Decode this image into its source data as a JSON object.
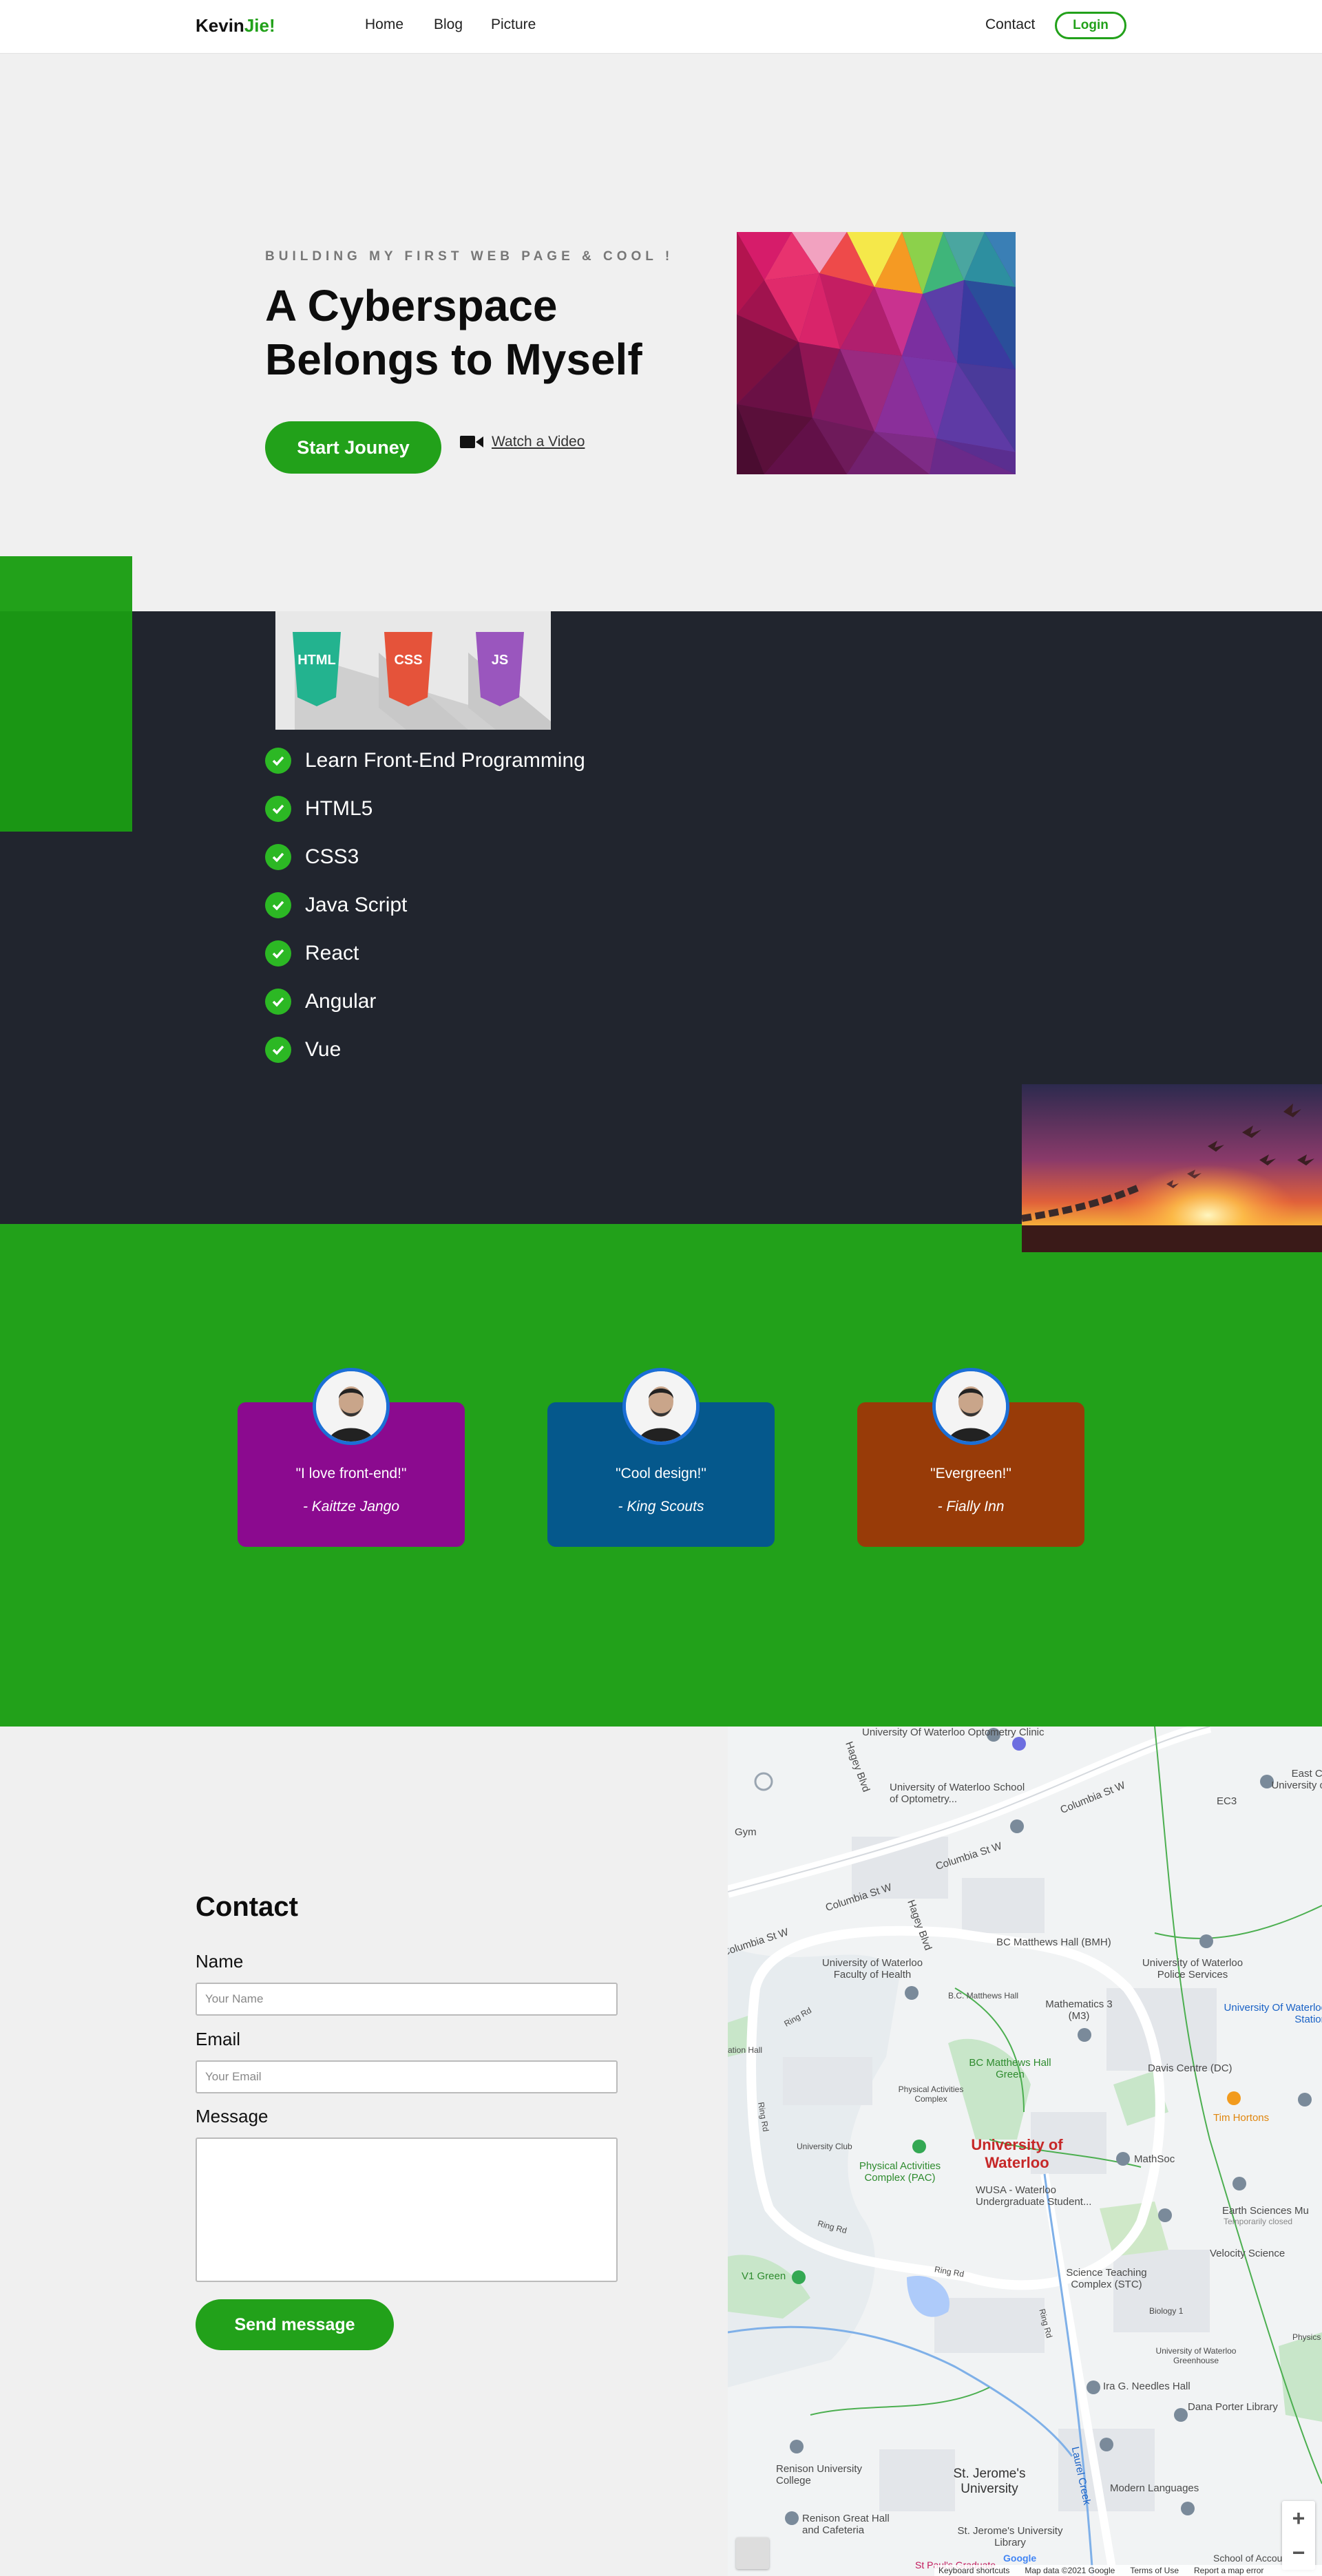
{
  "nav": {
    "brand_main": "Kevin",
    "brand_accent": "Jie!",
    "links": [
      "Home",
      "Blog",
      "Picture"
    ],
    "contact": "Contact",
    "login": "Login"
  },
  "hero": {
    "eyebrow": "BUILDING MY FIRST WEB PAGE & COOL !",
    "title_line1": "A Cyberspace",
    "title_line2": "Belongs to Myself",
    "cta": "Start Jouney",
    "watch": "Watch a Video"
  },
  "badges": [
    "HTML",
    "CSS",
    "JS"
  ],
  "skills": [
    "Learn Front-End Programming",
    "HTML5",
    "CSS3",
    "Java Script",
    "React",
    "Angular",
    "Vue"
  ],
  "testimonials": [
    {
      "quote": "\"I love front-end!\"",
      "author": "- Kaittze Jango",
      "color": "#8b0a8f"
    },
    {
      "quote": "\"Cool design!\"",
      "author": "- King Scouts",
      "color": "#05588c"
    },
    {
      "quote": "\"Evergreen!\"",
      "author": "- Fially Inn",
      "color": "#983b08"
    }
  ],
  "contact": {
    "title": "Contact",
    "name_label": "Name",
    "name_placeholder": "Your Name",
    "email_label": "Email",
    "email_placeholder": "Your Email",
    "message_label": "Message",
    "send": "Send message"
  },
  "map": {
    "labels": {
      "optometry_clinic": "University Of Waterloo Optometry Clinic",
      "optometry_school": "University of Waterloo School of Optometry...",
      "columbia_1": "Columbia St W",
      "columbia_2": "Columbia St W",
      "columbia_3": "Columbia St W",
      "columbia_4": "Columbia St W",
      "gym": "Gym",
      "hagey_1": "Hagey Blvd",
      "hagey_2": "Hagey Blvd",
      "faculty_health": "University of Waterloo Faculty of Health",
      "bc_matthews_hall": "B.C. Matthews Hall",
      "bc_matthews_bmh": "BC Matthews Hall (BMH)",
      "bc_matthews_green": "BC Matthews Hall Green",
      "police": "University of Waterloo Police Services",
      "station": "University Of Waterloo Station",
      "mathematics": "Mathematics 3 (M3)",
      "davis_centre": "Davis Centre (DC)",
      "tim_hortons": "Tim Hortons",
      "east_campus": "East Ca University of",
      "ec3": "EC3",
      "pac_complex": "Physical Activities Complex",
      "pac": "Physical Activities Complex (PAC)",
      "uw_red": "University of Waterloo",
      "university_club": "University Club",
      "mathsoc": "MathSoc",
      "wusa": "WUSA - Waterloo Undergraduate Student...",
      "earth_sciences": "Earth Sciences Mu",
      "temp_closed": "Temporarily closed",
      "velocity": "Velocity Science",
      "v1_green": "V1 Green",
      "science_teaching": "Science Teaching Complex (STC)",
      "biology": "Biology 1",
      "greenhouse": "University of Waterloo Greenhouse",
      "needles": "Ira G. Needles Hall",
      "dana_porter": "Dana Porter Library",
      "renison": "Renison University College",
      "st_jeromes": "St. Jerome's University",
      "modern_languages": "Modern Languages",
      "renison_great": "Renison Great Hall and Cafeteria",
      "sj_library": "St. Jerome's University Library",
      "laurel_creek": "Laurel Creek",
      "ring_1": "Ring Rd",
      "ring_2": "Ring Rd",
      "ring_3": "Ring Rd",
      "ring_4": "Ring Rd",
      "ring_5": "Ring Rd",
      "station_hall": "ation Hall",
      "physics": "Physics",
      "school_accounting": "School of Accounting",
      "st_pauls": "St Paul's Graduate"
    },
    "zoom_in": "+",
    "zoom_out": "−",
    "footer": [
      "Keyboard shortcuts",
      "Map data ©2021 Google",
      "Terms of Use",
      "Report a map error"
    ],
    "google": "Google"
  }
}
